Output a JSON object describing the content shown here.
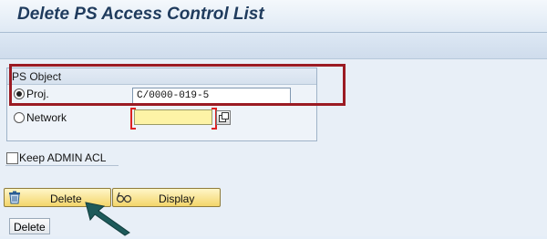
{
  "window": {
    "title": "Delete PS Access Control List"
  },
  "ps_object": {
    "group_title": "PS Object",
    "selection": "Proj.",
    "proj_label": "Proj.",
    "proj_value": "C/0000-019-5",
    "network_label": "Network",
    "network_value": ""
  },
  "options": {
    "keep_admin_acl_label": "Keep ADMIN ACL",
    "keep_admin_acl_checked": false
  },
  "buttons": {
    "delete_label": "Delete",
    "display_label": "Display"
  },
  "footer": {
    "delete_label": "Delete"
  },
  "colors": {
    "highlight": "#9b1b23",
    "button_fill": "#f3d56a",
    "required_field": "#fdf3a6",
    "arrow": "#1d5a5a"
  },
  "icons": {
    "delete": "trash-icon",
    "display": "glasses-icon",
    "value_help": "value-help-icon",
    "pointer": "pointer-arrow-icon"
  }
}
